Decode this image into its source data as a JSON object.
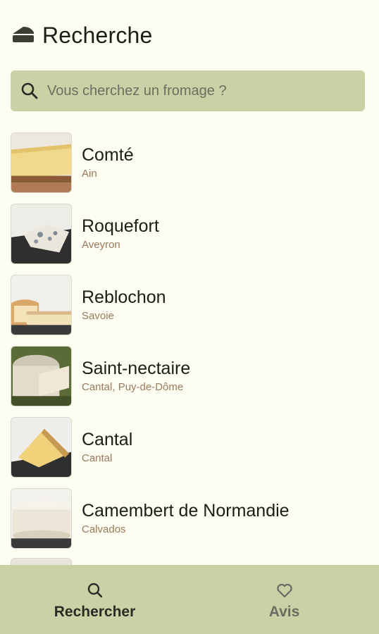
{
  "header": {
    "title": "Recherche",
    "icon": "cheese-icon"
  },
  "search": {
    "placeholder": "Vous cherchez un fromage ?",
    "icon": "search-icon"
  },
  "cheeses": [
    {
      "name": "Comté",
      "region": "Ain"
    },
    {
      "name": "Roquefort",
      "region": "Aveyron"
    },
    {
      "name": "Reblochon",
      "region": "Savoie"
    },
    {
      "name": "Saint-nectaire",
      "region": "Cantal, Puy-de-Dôme"
    },
    {
      "name": "Cantal",
      "region": "Cantal"
    },
    {
      "name": "Camembert de Normandie",
      "region": "Calvados"
    }
  ],
  "nav": {
    "search_label": "Rechercher",
    "reviews_label": "Avis"
  },
  "colors": {
    "background": "#fdfdf1",
    "accent": "#c9d2a7",
    "region_text": "#9a7a5e"
  }
}
